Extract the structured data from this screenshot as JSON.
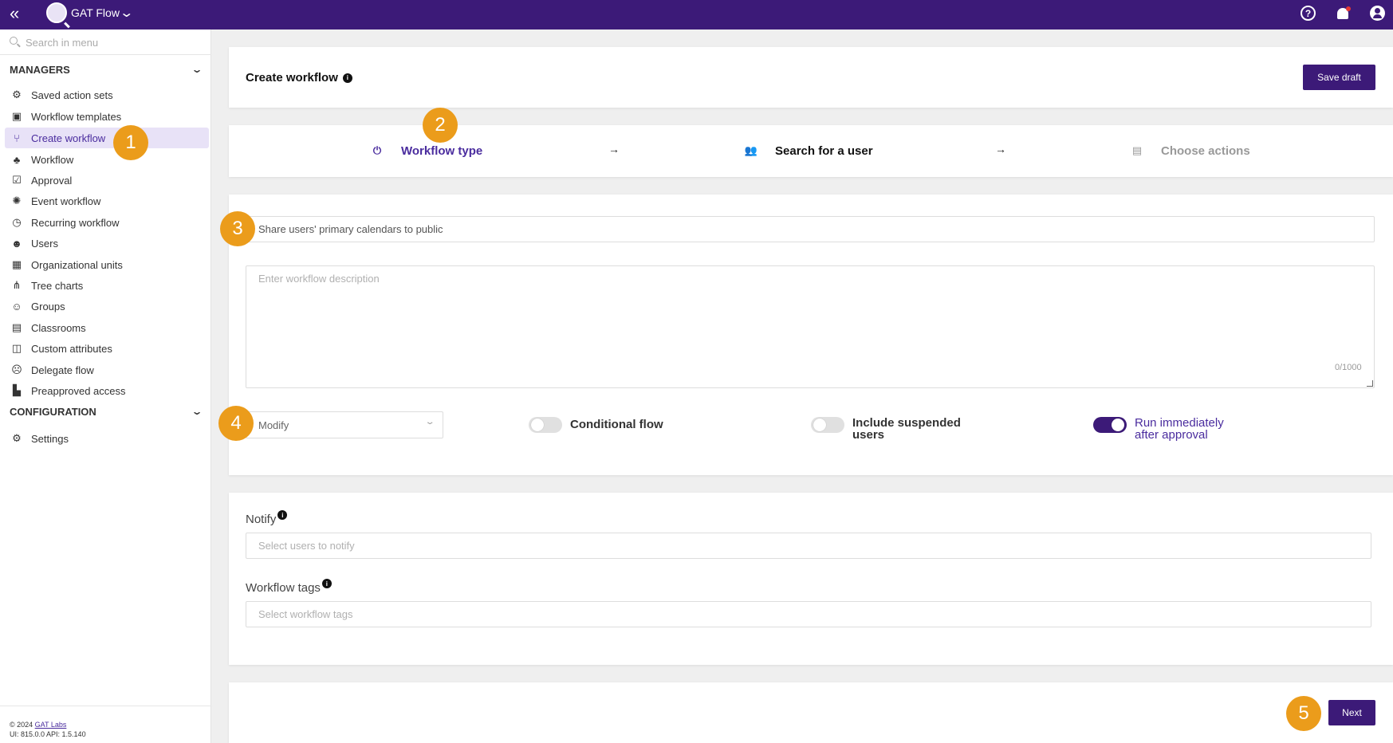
{
  "app": {
    "name": "GAT Flow"
  },
  "menu_search": {
    "placeholder": "Search in menu"
  },
  "sections": {
    "managers": "MANAGERS",
    "configuration": "CONFIGURATION"
  },
  "nav": [
    {
      "label": "Saved action sets",
      "icon": "gears-icon"
    },
    {
      "label": "Workflow templates",
      "icon": "template-icon"
    },
    {
      "label": "Create workflow",
      "icon": "fork-icon",
      "active": true
    },
    {
      "label": "Workflow",
      "icon": "hierarchy-icon"
    },
    {
      "label": "Approval",
      "icon": "approval-icon"
    },
    {
      "label": "Event workflow",
      "icon": "alarm-icon"
    },
    {
      "label": "Recurring workflow",
      "icon": "clock-icon"
    },
    {
      "label": "Users",
      "icon": "user-search-icon"
    },
    {
      "label": "Organizational units",
      "icon": "building-icon"
    },
    {
      "label": "Tree charts",
      "icon": "tree-icon"
    },
    {
      "label": "Groups",
      "icon": "groups-icon"
    },
    {
      "label": "Classrooms",
      "icon": "classroom-icon"
    },
    {
      "label": "Custom attributes",
      "icon": "attributes-icon"
    },
    {
      "label": "Delegate flow",
      "icon": "delegate-icon"
    },
    {
      "label": "Preapproved access",
      "icon": "preapproved-icon"
    }
  ],
  "config_nav": [
    {
      "label": "Settings",
      "icon": "gear-icon"
    }
  ],
  "footer": {
    "copyright": "© 2024",
    "company": "GAT Labs",
    "version": "UI: 815.0.0 API: 1.5.140"
  },
  "header": {
    "title": "Create workflow",
    "save_draft": "Save draft"
  },
  "steps": [
    {
      "label": "Workflow type",
      "state": "active"
    },
    {
      "label": "Search for a user",
      "state": "done"
    },
    {
      "label": "Choose actions",
      "state": "pending"
    }
  ],
  "form": {
    "name_value": "Share users' primary calendars to public",
    "description_placeholder": "Enter workflow description",
    "description_counter": "0/1000",
    "type_select": "Modify",
    "conditional_flow": "Conditional flow",
    "include_suspended_1": "Include suspended",
    "include_suspended_2": "users",
    "run_immediately_1": "Run immediately",
    "run_immediately_2": "after approval",
    "notify_label": "Notify",
    "notify_placeholder": "Select users to notify",
    "tags_label": "Workflow tags",
    "tags_placeholder": "Select workflow tags",
    "next": "Next"
  },
  "toggles": {
    "conditional_flow": false,
    "include_suspended": false,
    "run_immediately": true
  },
  "markers": [
    "1",
    "2",
    "3",
    "4",
    "5"
  ],
  "colors": {
    "brand": "#3c1a78",
    "marker": "#eb9c1b",
    "active_bg": "#e8e2f7"
  }
}
